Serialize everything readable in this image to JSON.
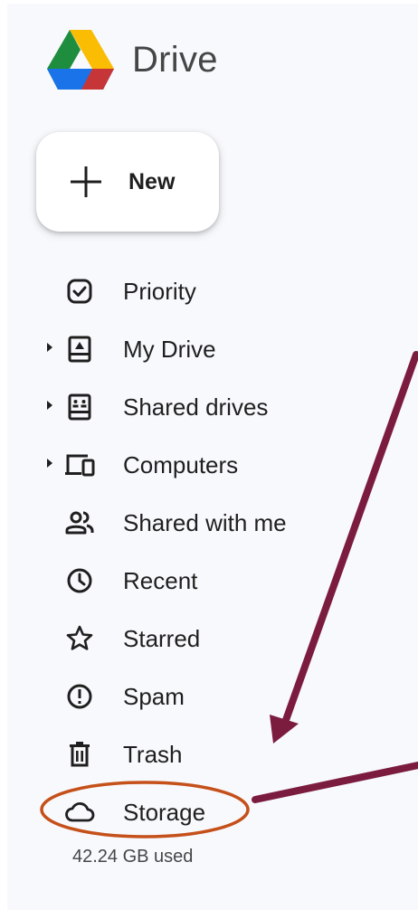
{
  "app": {
    "name": "Drive"
  },
  "new_button": {
    "label": "New"
  },
  "nav": {
    "items": [
      {
        "label": "Priority",
        "icon": "priority-check-icon",
        "has_caret": false
      },
      {
        "label": "My Drive",
        "icon": "my-drive-icon",
        "has_caret": true
      },
      {
        "label": "Shared drives",
        "icon": "shared-drives-icon",
        "has_caret": true
      },
      {
        "label": "Computers",
        "icon": "computers-icon",
        "has_caret": true
      },
      {
        "label": "Shared with me",
        "icon": "shared-with-me-icon",
        "has_caret": false
      },
      {
        "label": "Recent",
        "icon": "clock-icon",
        "has_caret": false
      },
      {
        "label": "Starred",
        "icon": "star-icon",
        "has_caret": false
      },
      {
        "label": "Spam",
        "icon": "spam-icon",
        "has_caret": false
      },
      {
        "label": "Trash",
        "icon": "trash-icon",
        "has_caret": false
      },
      {
        "label": "Storage",
        "icon": "cloud-icon",
        "has_caret": false
      }
    ]
  },
  "storage": {
    "used_text": "42.24 GB used"
  },
  "colors": {
    "sidebar_bg": "#f8f9fc",
    "text": "#1f1f1f",
    "annotation_arrow": "#7b1c3f",
    "annotation_ellipse": "#c5501a"
  }
}
